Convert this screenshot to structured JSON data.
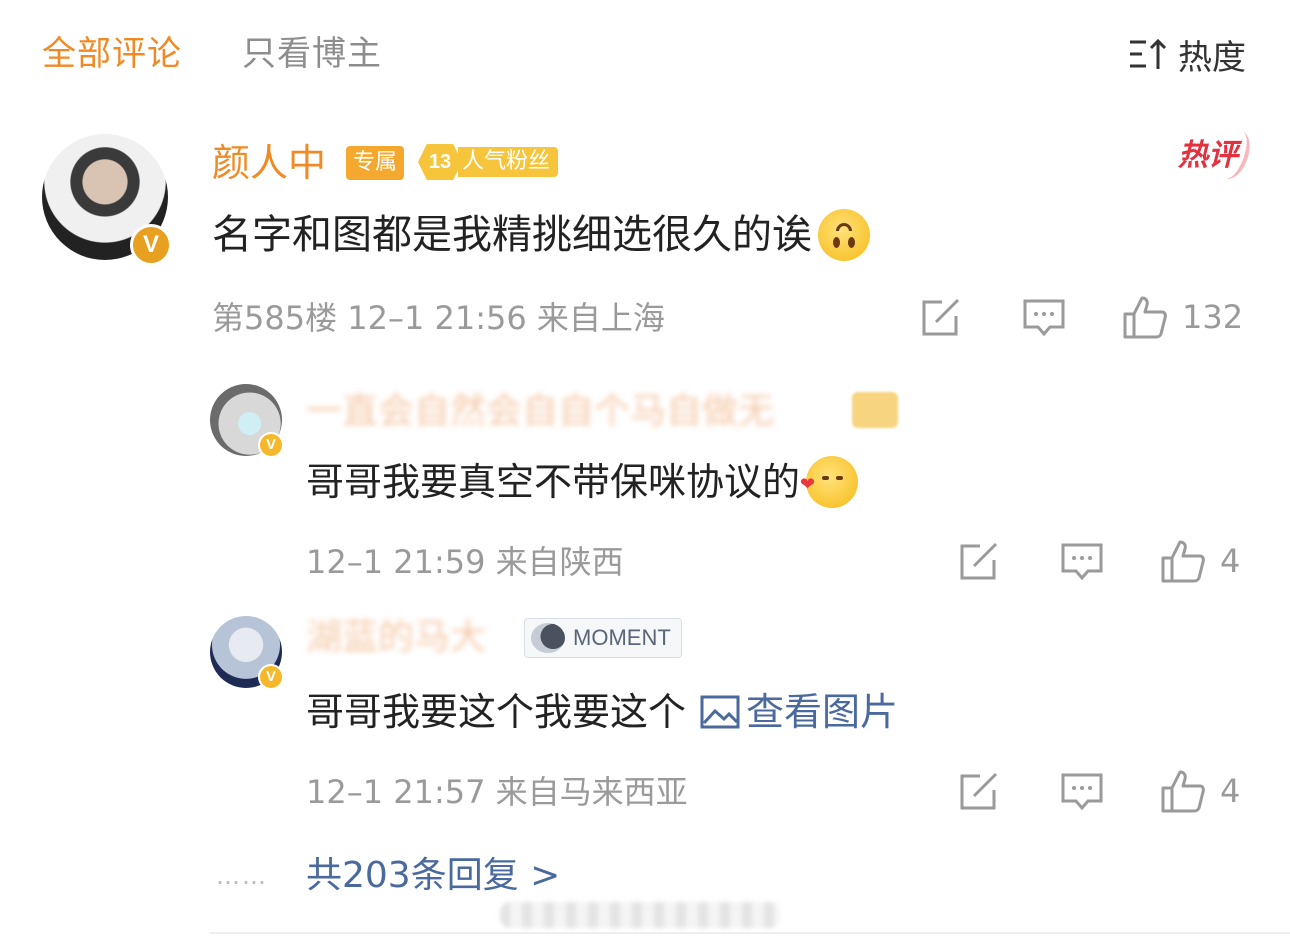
{
  "tabs": {
    "all_label": "全部评论",
    "blogger_label": "只看博主",
    "sort_label": "热度",
    "sort_icon": "sort-icon"
  },
  "main_comment": {
    "username": "颜人中",
    "badge_exclusive": "专属",
    "fan_level": "13",
    "fan_label": "人气粉丝",
    "hot_tag": "热评",
    "text": "名字和图都是我精挑细选很久的诶",
    "emoji": "upside-down-face",
    "meta": "第585楼 12–1 21:56 来自上海",
    "likes": "132"
  },
  "replies": [
    {
      "username": "一直会自然会自自个马自做无",
      "text": "哥哥我要真空不带保咪协议的",
      "emoji": "kissing-face",
      "meta": "12–1 21:59 来自陕西",
      "likes": "4"
    },
    {
      "username": "湖蓝的马大",
      "badge": "MOMENT",
      "text": "哥哥我要这个我要这个",
      "view_image": "查看图片",
      "meta": "12–1 21:57 来自马来西亚",
      "likes": "4"
    }
  ],
  "more_replies": "共203条回复 >",
  "dots": "……",
  "colors": {
    "accent": "#f08a24",
    "link": "#4a6a9e",
    "muted": "#9a9a9a",
    "hot": "#e2313f"
  }
}
